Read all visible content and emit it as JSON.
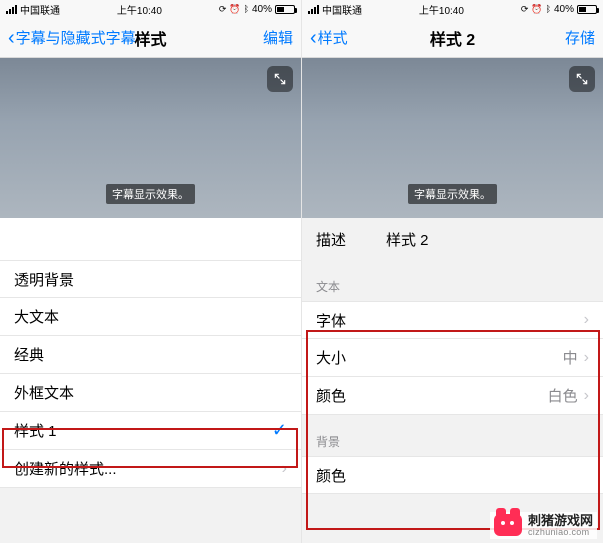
{
  "status": {
    "carrier": "中国联通",
    "time": "上午10:40",
    "battery_pct": "40%"
  },
  "left": {
    "nav_back": "字幕与隐藏式字幕",
    "nav_title": "样式",
    "nav_action": "编辑",
    "caption_sample": "字幕显示效果。",
    "styles": [
      "透明背景",
      "大文本",
      "经典",
      "外框文本",
      "样式 1"
    ],
    "create_new": "创建新的样式..."
  },
  "right": {
    "nav_back": "样式",
    "nav_title": "样式 2",
    "nav_action": "存储",
    "caption_sample": "字幕显示效果。",
    "desc_label": "描述",
    "desc_value": "样式 2",
    "section_text": "文本",
    "font_label": "字体",
    "size_label": "大小",
    "size_value": "中",
    "color_label": "颜色",
    "color_value": "白色",
    "section_bg": "背景",
    "bg_color_label": "颜色"
  },
  "watermark": {
    "name": "刺猪游戏网",
    "domain": "cizhuniao.com"
  }
}
